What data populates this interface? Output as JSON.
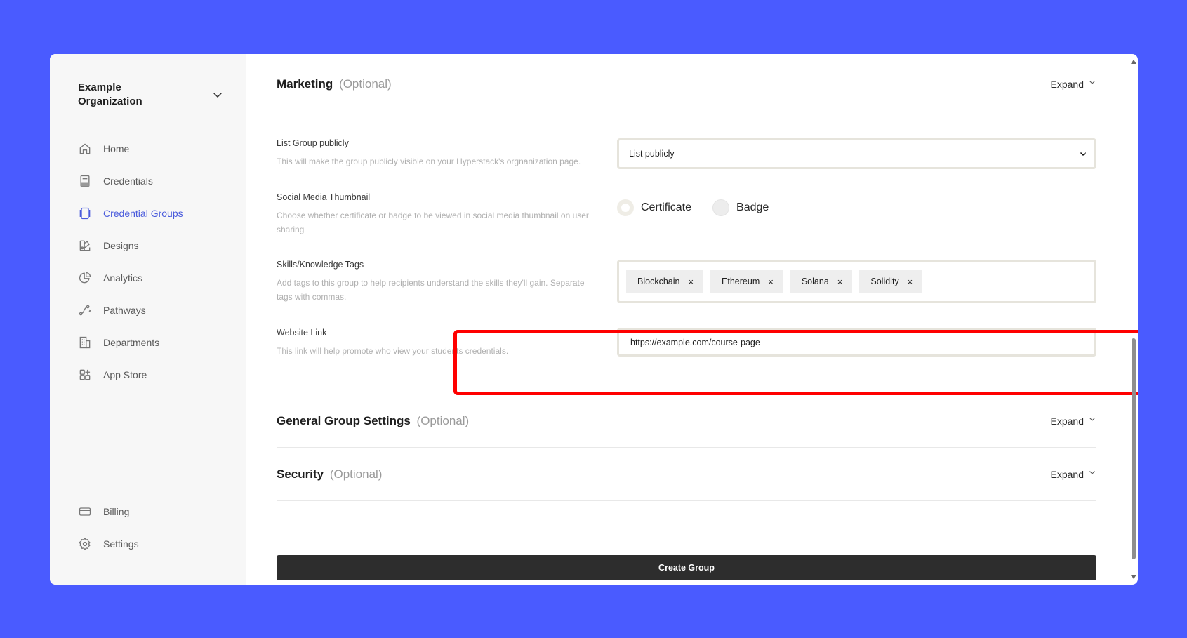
{
  "sidebar": {
    "org_name": "Example Organization",
    "items": [
      {
        "label": "Home",
        "icon": "home-icon"
      },
      {
        "label": "Credentials",
        "icon": "credentials-icon"
      },
      {
        "label": "Credential Groups",
        "icon": "credential-groups-icon",
        "active": true
      },
      {
        "label": "Designs",
        "icon": "designs-icon"
      },
      {
        "label": "Analytics",
        "icon": "analytics-icon"
      },
      {
        "label": "Pathways",
        "icon": "pathways-icon"
      },
      {
        "label": "Departments",
        "icon": "departments-icon"
      },
      {
        "label": "App Store",
        "icon": "app-store-icon"
      }
    ],
    "bottom_items": [
      {
        "label": "Billing",
        "icon": "billing-icon"
      },
      {
        "label": "Settings",
        "icon": "settings-icon"
      }
    ]
  },
  "marketing": {
    "title": "Marketing",
    "optional": "(Optional)",
    "expand": "Expand",
    "list_group": {
      "title": "List Group publicly",
      "desc": "This will make the group publicly visible on your Hyperstack's orgnanization page.",
      "value": "List publicly"
    },
    "social": {
      "title": "Social Media Thumbnail",
      "desc": "Choose whether certificate or badge to be viewed in social media thumbnail on user sharing",
      "option_certificate": "Certificate",
      "option_badge": "Badge",
      "selected": "Certificate"
    },
    "tags": {
      "title": "Skills/Knowledge Tags",
      "desc": "Add tags to this group to help recipients understand the skills they'll gain. Separate tags with commas.",
      "items": [
        "Blockchain",
        "Ethereum",
        "Solana",
        "Solidity"
      ],
      "remove_symbol": "×"
    },
    "website": {
      "title": "Website Link",
      "desc": "This link will help promote who view your students credentials.",
      "value": "https://example.com/course-page"
    }
  },
  "general": {
    "title": "General Group Settings",
    "optional": "(Optional)",
    "expand": "Expand"
  },
  "security": {
    "title": "Security",
    "optional": "(Optional)",
    "expand": "Expand"
  },
  "create_button": "Create Group",
  "colors": {
    "background": "#4a5bff",
    "accent": "#4a5bdc",
    "highlight": "#ff0000",
    "button": "#2d2d2d"
  }
}
